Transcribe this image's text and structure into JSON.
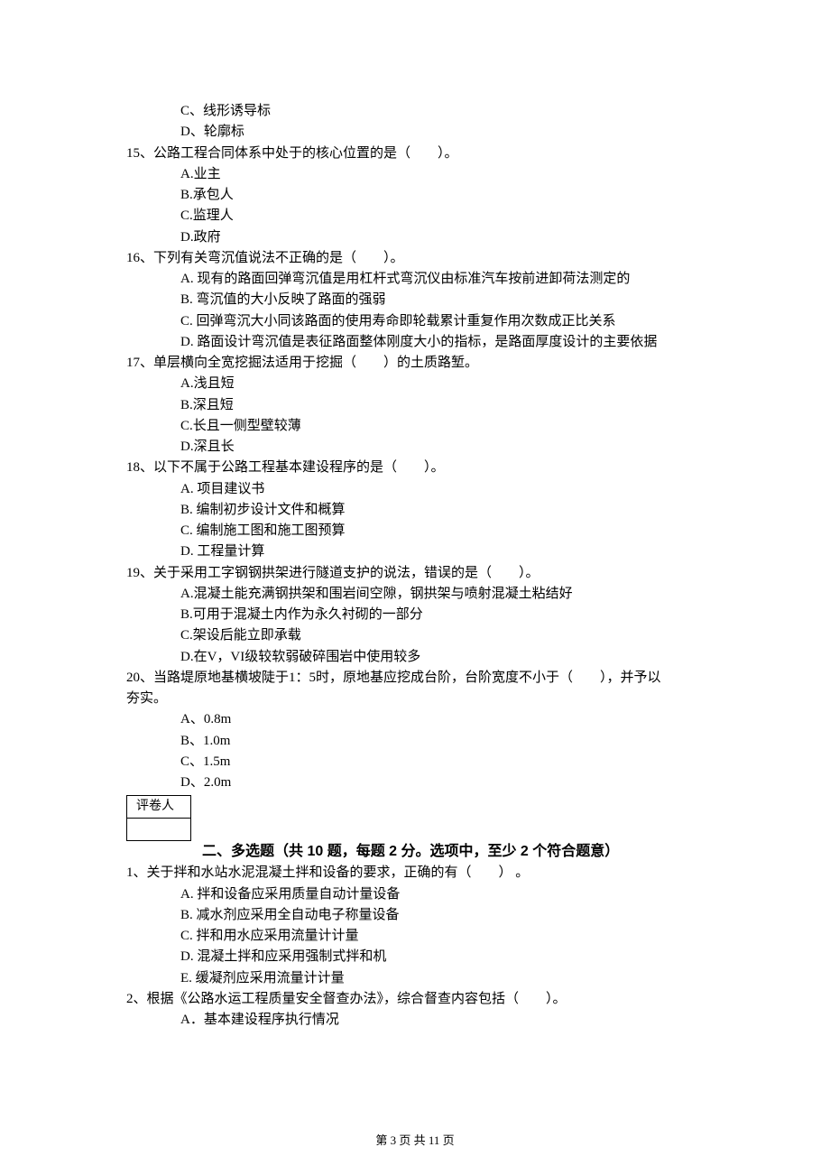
{
  "orphan_options": {
    "c": "C、线形诱导标",
    "d": "D、轮廓标"
  },
  "q15": {
    "stem": "15、公路工程合同体系中处于的核心位置的是（　　）。",
    "a": "A.业主",
    "b": "B.承包人",
    "c": "C.监理人",
    "d": "D.政府"
  },
  "q16": {
    "stem": "16、下列有关弯沉值说法不正确的是（　　）。",
    "a": "A. 现有的路面回弹弯沉值是用杠杆式弯沉仪由标准汽车按前进卸荷法测定的",
    "b": "B. 弯沉值的大小反映了路面的强弱",
    "c": "C. 回弹弯沉大小同该路面的使用寿命即轮载累计重复作用次数成正比关系",
    "d": "D. 路面设计弯沉值是表征路面整体刚度大小的指标，是路面厚度设计的主要依据"
  },
  "q17": {
    "stem": "17、单层横向全宽挖掘法适用于挖掘（　　）的土质路堑。",
    "a": "A.浅且短",
    "b": "B.深且短",
    "c": "C.长且一侧型壁较薄",
    "d": "D.深且长"
  },
  "q18": {
    "stem": "18、以下不属于公路工程基本建设程序的是（　　）。",
    "a": "A. 项目建议书",
    "b": "B. 编制初步设计文件和概算",
    "c": "C. 编制施工图和施工图预算",
    "d": "D. 工程量计算"
  },
  "q19": {
    "stem": "19、关于采用工字钢钢拱架进行隧道支护的说法，错误的是（　　）。",
    "a": "A.混凝土能充满钢拱架和围岩间空隙，钢拱架与喷射混凝土粘结好",
    "b": "B.可用于混凝土内作为永久衬砌的一部分",
    "c": "C.架设后能立即承载",
    "d": "D.在V，VI级较软弱破碎围岩中使用较多"
  },
  "q20": {
    "stem1": "20、当路堤原地基横坡陡于1：5时，原地基应挖成台阶，台阶宽度不小于（　　），并予以",
    "stem2": "夯实。",
    "a": "A、0.8m",
    "b": "B、1.0m",
    "c": "C、1.5m",
    "d": "D、2.0m"
  },
  "section2": {
    "scorer_label": "评卷人",
    "title": "二、多选题（共 10 题，每题 2 分。选项中，至少 2 个符合题意）"
  },
  "mq1": {
    "stem": "1、关于拌和水站水泥混凝土拌和设备的要求，正确的有（　　） 。",
    "a": "A. 拌和设备应采用质量自动计量设备",
    "b": "B. 减水剂应采用全自动电子称量设备",
    "c": "C. 拌和用水应采用流量计计量",
    "d": "D. 混凝土拌和应采用强制式拌和机",
    "e": "E. 缓凝剂应采用流量计计量"
  },
  "mq2": {
    "stem": "2、根据《公路水运工程质量安全督查办法》，综合督查内容包括（　　）。",
    "a": "A．基本建设程序执行情况"
  },
  "footer": {
    "text": "第 3 页 共 11 页"
  }
}
